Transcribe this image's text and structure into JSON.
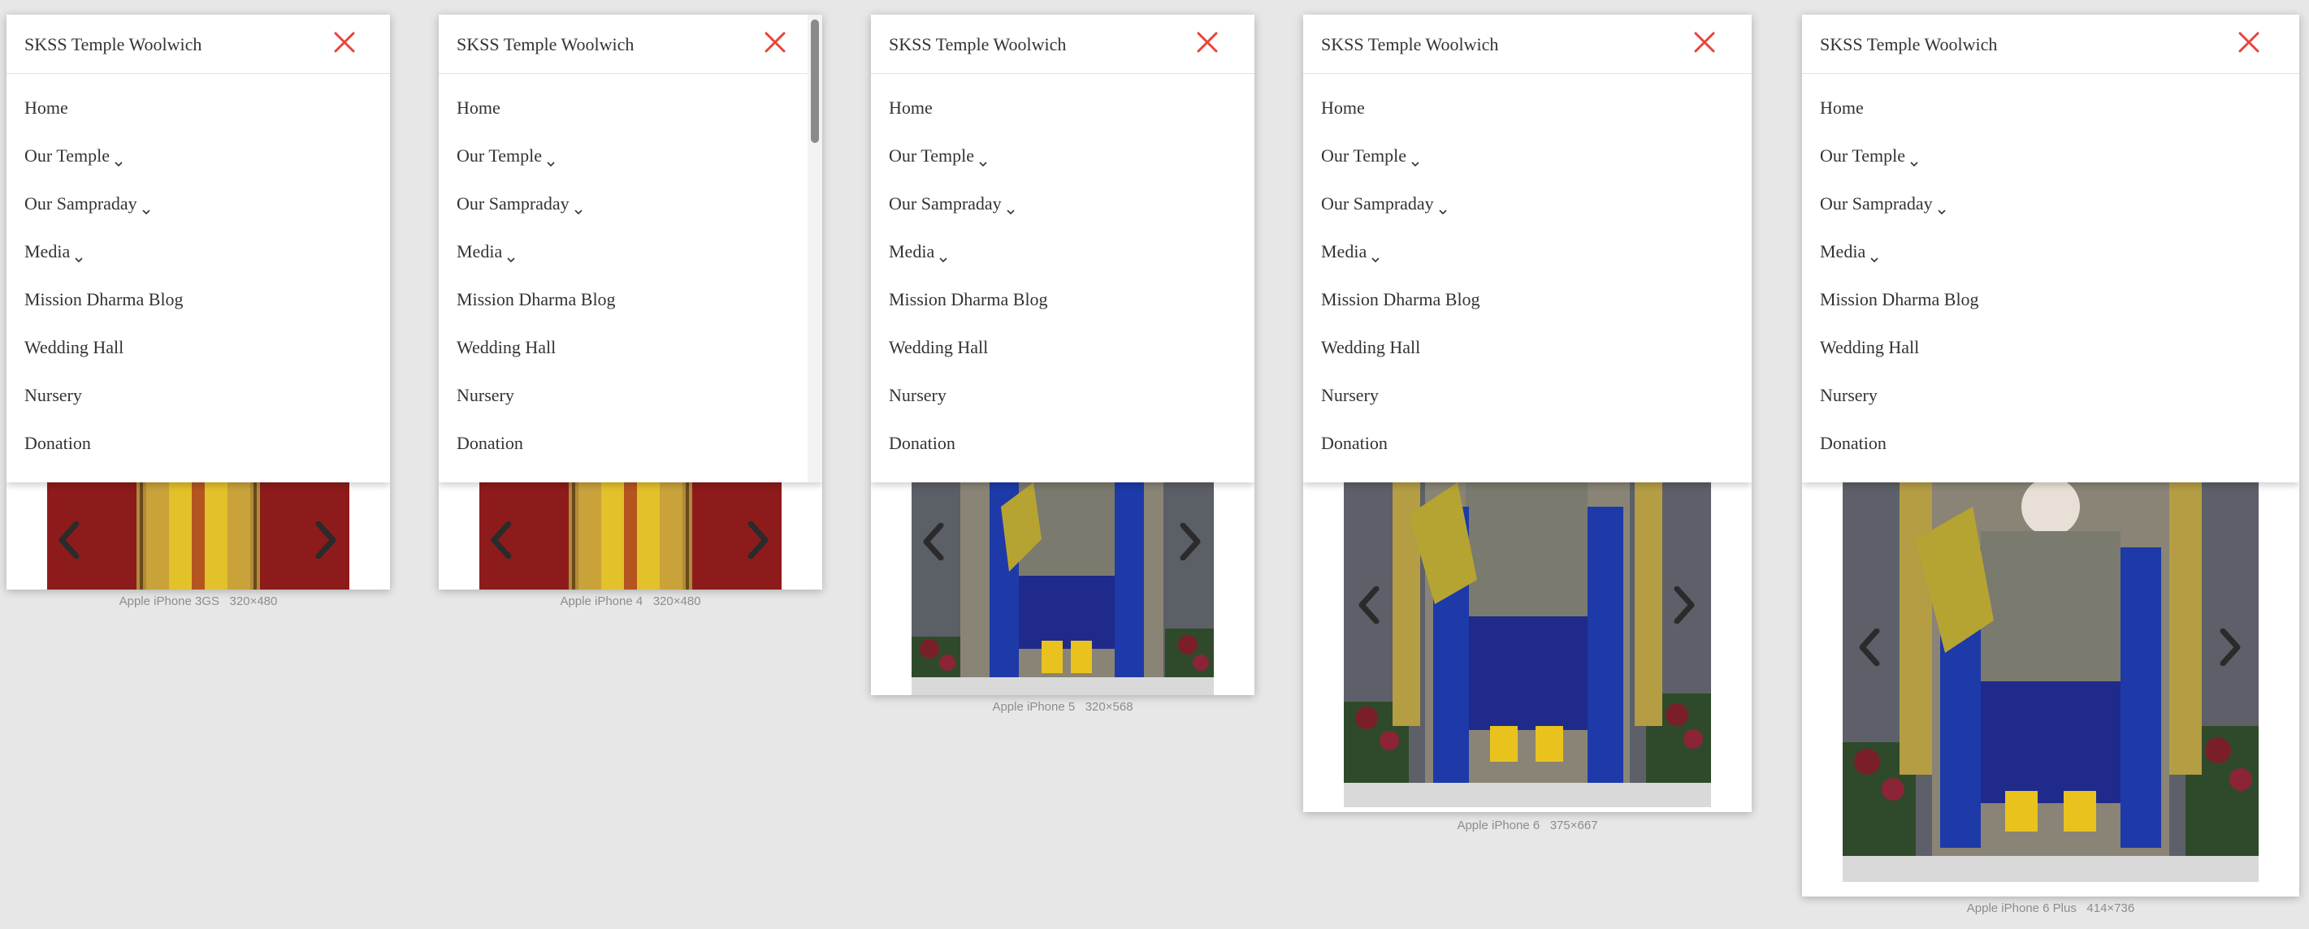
{
  "site_title": "SKSS Temple Woolwich",
  "menu": [
    {
      "label": "Home",
      "has_dropdown": false
    },
    {
      "label": "Our Temple",
      "has_dropdown": true
    },
    {
      "label": "Our Sampraday",
      "has_dropdown": true
    },
    {
      "label": "Media",
      "has_dropdown": true
    },
    {
      "label": "Mission Dharma Blog",
      "has_dropdown": false
    },
    {
      "label": "Wedding Hall",
      "has_dropdown": false
    },
    {
      "label": "Nursery",
      "has_dropdown": false
    },
    {
      "label": "Donation",
      "has_dropdown": false
    }
  ],
  "devices": [
    {
      "name": "Apple iPhone 3GS",
      "resolution": "320×480"
    },
    {
      "name": "Apple iPhone 4",
      "resolution": "320×480"
    },
    {
      "name": "Apple iPhone 5",
      "resolution": "320×568"
    },
    {
      "name": "Apple iPhone 6",
      "resolution": "375×667"
    },
    {
      "name": "Apple iPhone 6 Plus",
      "resolution": "414×736"
    }
  ],
  "colors": {
    "close_icon": "#e8433c",
    "page_background": "#e6e7e6",
    "menu_text": "#333333",
    "caption_text": "#8c8c8c"
  },
  "icons": {
    "close": "close-icon",
    "dropdown": "chevron-down-icon",
    "prev": "chevron-left-icon",
    "next": "chevron-right-icon"
  }
}
